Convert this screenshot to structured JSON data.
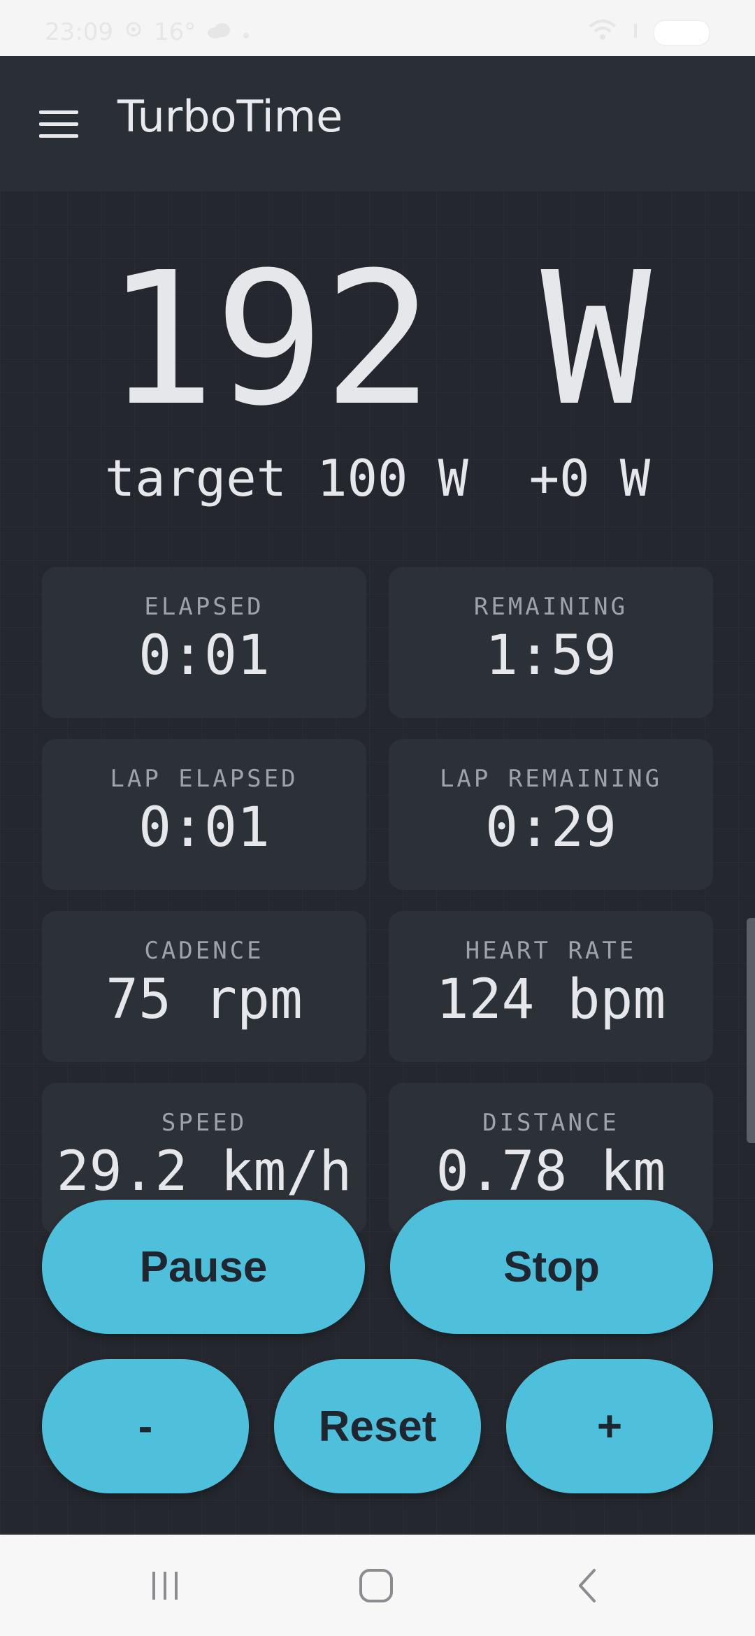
{
  "status_bar": {
    "time": "23:09",
    "temperature": "16°",
    "icons": [
      "signal-icon",
      "cloud-icon",
      "wifi-icon",
      "battery-icon"
    ]
  },
  "app_bar": {
    "title": "TurboTime",
    "menu_icon": "hamburger-menu-icon"
  },
  "power": {
    "current": "192 W",
    "target_text": "target 100 W  +0 W"
  },
  "stats": [
    {
      "label": "ELAPSED",
      "value": "0:01"
    },
    {
      "label": "REMAINING",
      "value": "1:59"
    },
    {
      "label": "LAP ELAPSED",
      "value": "0:01"
    },
    {
      "label": "LAP REMAINING",
      "value": "0:29"
    },
    {
      "label": "CADENCE",
      "value": "75 rpm"
    },
    {
      "label": "HEART RATE",
      "value": "124 bpm"
    },
    {
      "label": "SPEED",
      "value": "29.2 km/h"
    },
    {
      "label": "DISTANCE",
      "value": "0.78 km"
    }
  ],
  "controls": {
    "pause": "Pause",
    "stop": "Stop",
    "minus": "-",
    "reset": "Reset",
    "plus": "+"
  },
  "colors": {
    "app_bar": "#2a2e35",
    "background": "#24272d",
    "card": "#2c3037",
    "accent": "#4fc0db",
    "text": "#e5e7ea",
    "label": "#9ea3ab"
  },
  "nav_bar": {
    "icons": [
      "recent-apps-icon",
      "home-icon",
      "back-icon"
    ]
  }
}
